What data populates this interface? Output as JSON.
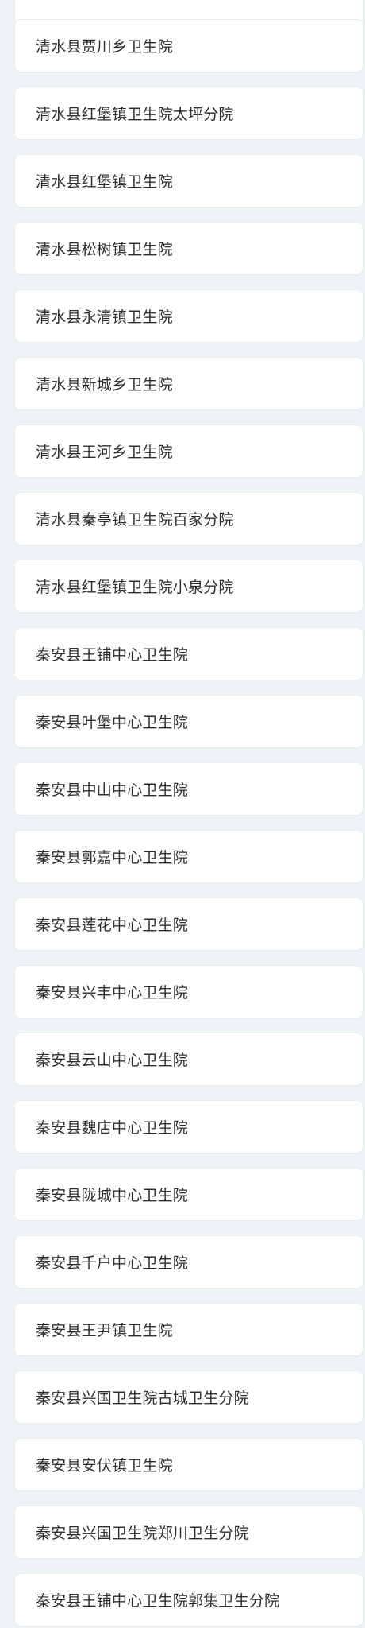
{
  "items": [
    {
      "label": ""
    },
    {
      "label": "清水县贾川乡卫生院"
    },
    {
      "label": "清水县红堡镇卫生院太坪分院"
    },
    {
      "label": "清水县红堡镇卫生院"
    },
    {
      "label": "清水县松树镇卫生院"
    },
    {
      "label": "清水县永清镇卫生院"
    },
    {
      "label": "清水县新城乡卫生院"
    },
    {
      "label": "清水县王河乡卫生院"
    },
    {
      "label": "清水县秦亭镇卫生院百家分院"
    },
    {
      "label": "清水县红堡镇卫生院小泉分院"
    },
    {
      "label": "秦安县王铺中心卫生院"
    },
    {
      "label": "秦安县叶堡中心卫生院"
    },
    {
      "label": "秦安县中山中心卫生院"
    },
    {
      "label": "秦安县郭嘉中心卫生院"
    },
    {
      "label": "秦安县莲花中心卫生院"
    },
    {
      "label": "秦安县兴丰中心卫生院"
    },
    {
      "label": "秦安县云山中心卫生院"
    },
    {
      "label": "秦安县魏店中心卫生院"
    },
    {
      "label": "秦安县陇城中心卫生院"
    },
    {
      "label": "秦安县千户中心卫生院"
    },
    {
      "label": "秦安县王尹镇卫生院"
    },
    {
      "label": "秦安县兴国卫生院古城卫生分院"
    },
    {
      "label": "秦安县安伏镇卫生院"
    },
    {
      "label": "秦安县兴国卫生院郑川卫生分院"
    },
    {
      "label": "秦安县王铺中心卫生院郭集卫生分院"
    }
  ]
}
